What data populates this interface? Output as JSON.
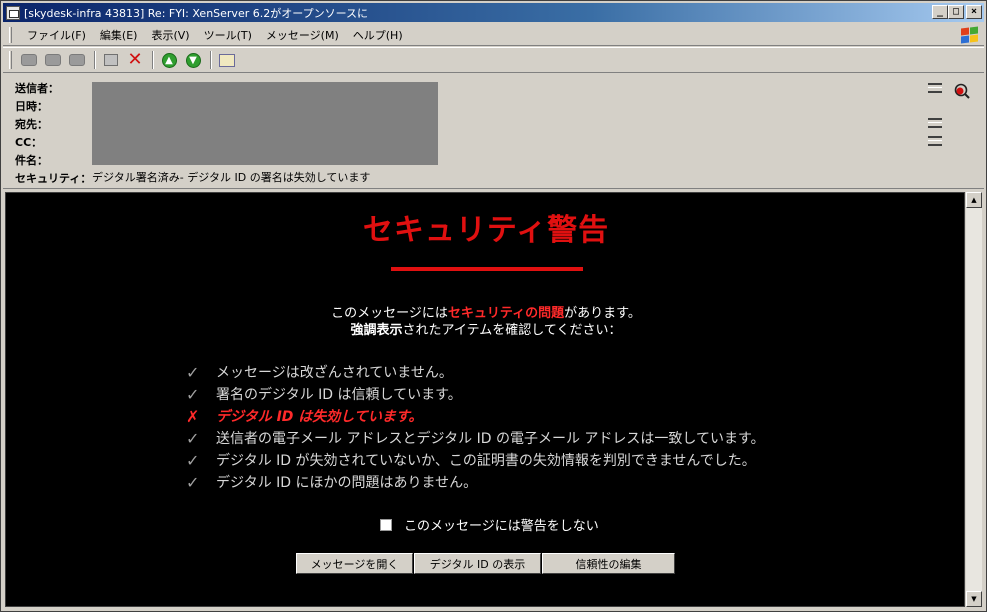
{
  "window": {
    "title": "[skydesk-infra 43813] Re: FYI: XenServer  6.2がオープンソースに"
  },
  "menu": [
    "ファイル(F)",
    "編集(E)",
    "表示(V)",
    "ツール(T)",
    "メッセージ(M)",
    "ヘルプ(H)"
  ],
  "toolbar": {
    "icons": [
      "reply-icon",
      "reply-all-icon",
      "forward-icon",
      "print-icon",
      "delete-icon",
      "previous-icon",
      "next-icon",
      "address-book-icon"
    ]
  },
  "header": {
    "from_label": "送信者：",
    "date_label": "日時：",
    "to_label": "宛先：",
    "cc_label": "CC：",
    "subject_label": "件名：",
    "security_label": "セキュリティ：",
    "security_value": "デジタル署名済み- デジタル ID の署名は失効しています"
  },
  "warning": {
    "title": "セキュリティ警告",
    "intro_line1_pre": "このメッセージには",
    "intro_line1_hl": "セキュリティの問題",
    "intro_line1_post": "があります。",
    "intro_line2_bold": "強調表示",
    "intro_line2_post": "されたアイテムを確認してください：",
    "checks": [
      {
        "mark": "✓",
        "text": "メッセージは改ざんされていません。",
        "bad": false
      },
      {
        "mark": "✓",
        "text": "署名のデジタル ID は信頼しています。",
        "bad": false
      },
      {
        "mark": "✗",
        "text": "デジタル ID は失効しています。",
        "bad": true
      },
      {
        "mark": "✓",
        "text": "送信者の電子メール アドレスとデジタル ID の電子メール アドレスは一致しています。",
        "bad": false
      },
      {
        "mark": "✓",
        "text": "デジタル ID が失効されていないか、この証明書の失効情報を判別できませんでした。",
        "bad": false
      },
      {
        "mark": "✓",
        "text": "デジタル ID にほかの問題はありません。",
        "bad": false
      }
    ],
    "dont_warn_label": "このメッセージには警告をしない",
    "dont_warn_checked": false,
    "buttons": {
      "open": "メッセージを開く",
      "view_id": "デジタル ID の表示",
      "edit_trust": "信頼性の編集"
    }
  },
  "colors": {
    "warning_red": "#e01010",
    "titlebar": "#0a246a"
  }
}
